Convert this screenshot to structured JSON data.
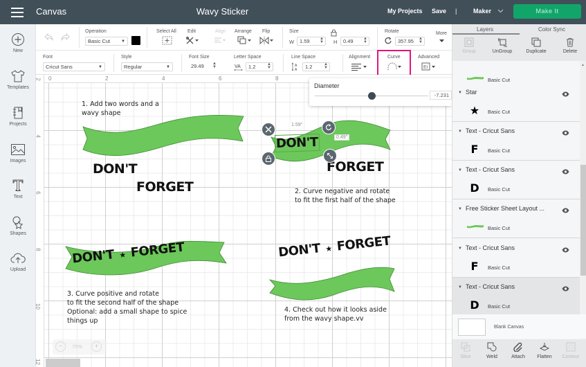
{
  "topbar": {
    "app_label": "Canvas",
    "project_title": "Wavy Sticker",
    "my_projects": "My Projects",
    "save": "Save",
    "separator": "|",
    "machine": "Maker",
    "make_it": "Make It"
  },
  "sidebar": {
    "items": [
      {
        "label": "New",
        "icon": "plus-circle-icon"
      },
      {
        "label": "Templates",
        "icon": "tshirt-icon"
      },
      {
        "label": "Projects",
        "icon": "notebook-icon"
      },
      {
        "label": "Images",
        "icon": "image-icon"
      },
      {
        "label": "Text",
        "icon": "text-t-icon"
      },
      {
        "label": "Shapes",
        "icon": "shapes-icon"
      },
      {
        "label": "Upload",
        "icon": "cloud-upload-icon"
      }
    ]
  },
  "toolbar": {
    "operation_label": "Operation",
    "operation_value": "Basic Cut",
    "operation_color": "#000000",
    "select_all": "Select All",
    "edit": "Edit",
    "align": "Align",
    "arrange": "Arrange",
    "flip": "Flip",
    "size_label": "Size",
    "w_label": "W",
    "w_value": "1.59",
    "h_label": "H",
    "h_value": "0.49",
    "rotate_label": "Rotate",
    "rotate_value": "357.95",
    "more": "More"
  },
  "text_toolbar": {
    "font_label": "Font",
    "font_value": "Cricut Sans",
    "style_label": "Style",
    "style_value": "Regular",
    "font_size_label": "Font Size",
    "font_size_value": "29.49",
    "letter_space_label": "Letter Space",
    "letter_space_value": "1.2",
    "line_space_label": "Line Space",
    "line_space_value": "1.2",
    "alignment_label": "Alignment",
    "curve_label": "Curve",
    "advanced_label": "Advanced",
    "highlight_color": "#e2137e"
  },
  "curve_popup": {
    "label": "Diameter",
    "value": "-7.231",
    "slider_fraction": 0.5
  },
  "canvas": {
    "ruler_top": [
      "0",
      "2",
      "4",
      "6",
      "8"
    ],
    "ruler_left": [
      "2",
      "4",
      "6",
      "8",
      "10",
      "12"
    ],
    "zoom_level": "75%",
    "shape_color": "#6cc85a",
    "notes": [
      {
        "lines": [
          "1. Add two words and a",
          "wavy shape"
        ]
      },
      {
        "lines": [
          "2. Curve negative and rotate",
          "to fit the first half of the shape"
        ]
      },
      {
        "lines": [
          "3. Curve positive and rotate",
          "to fit the second half of the shape",
          "Optional: add a small shape to spice",
          "things up"
        ]
      },
      {
        "lines": [
          "4. Check out how it looks aside",
          "from the wavy shape.vv"
        ]
      }
    ],
    "words": {
      "first": "DON'T",
      "second": "FORGET",
      "star": "★"
    },
    "selection": {
      "width_tag": "1.59\"",
      "height_tag": "0.49\""
    }
  },
  "layers_panel": {
    "tabs": [
      "Layers",
      "Color Sync"
    ],
    "tools": [
      "Group",
      "UnGroup",
      "Duplicate",
      "Delete"
    ],
    "layers": [
      {
        "name": "",
        "sub": "Basic Cut",
        "thumb": "wave"
      },
      {
        "name": "Star",
        "sub": "Basic Cut",
        "thumb": "★"
      },
      {
        "name": "Text - Cricut Sans",
        "sub": "Basic Cut",
        "thumb": "F"
      },
      {
        "name": "Text - Cricut Sans",
        "sub": "Basic Cut",
        "thumb": "D"
      },
      {
        "name": "Free Sticker Sheet Layout ...",
        "sub": "Basic Cut",
        "thumb": "wave"
      },
      {
        "name": "Text - Cricut Sans",
        "sub": "Basic Cut",
        "thumb": "F"
      },
      {
        "name": "Text - Cricut Sans",
        "sub": "Basic Cut",
        "thumb": "D",
        "selected": true
      }
    ],
    "blank_canvas": "Blank Canvas",
    "bottom_tools": [
      "Slice",
      "Weld",
      "Attach",
      "Flatten",
      "Contour"
    ]
  }
}
